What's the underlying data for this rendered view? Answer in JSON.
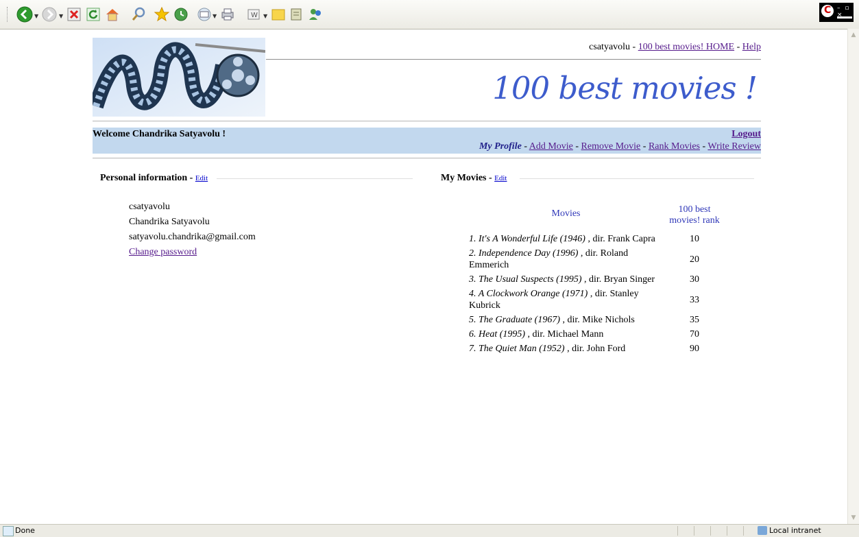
{
  "toolbar": {
    "icons": [
      "back-icon",
      "forward-icon",
      "stop-icon",
      "refresh-icon",
      "home-icon",
      "search-icon",
      "favorites-icon",
      "history-icon",
      "mail-icon",
      "print-icon",
      "word-icon",
      "folder-icon",
      "edit-icon",
      "messenger-icon"
    ]
  },
  "header": {
    "username": "csatyavolu",
    "separator": " - ",
    "home_link": "100 best movies! HOME",
    "help_link": "Help",
    "site_title": "100 best movies !"
  },
  "welcome": {
    "text": "Welcome Chandrika Satyavolu !",
    "logout": "Logout"
  },
  "menu": {
    "current": "My Profile",
    "items": [
      "Add Movie",
      "Remove Movie",
      "Rank Movies",
      "Write Review"
    ]
  },
  "personal": {
    "title": "Personal information",
    "edit": "Edit",
    "username": "csatyavolu",
    "fullname": "Chandrika Satyavolu",
    "email": "satyavolu.chandrika@gmail.com",
    "change_password": "Change password"
  },
  "my_movies": {
    "title": "My Movies",
    "edit": "Edit",
    "col_movies": "Movies",
    "col_rank": "100 best movies! rank",
    "rows": [
      {
        "title": "1. It's A Wonderful Life (1946)",
        "dir": " , dir. Frank Capra",
        "rank": "10"
      },
      {
        "title": "2. Independence Day (1996)",
        "dir": " , dir. Roland Emmerich",
        "rank": "20"
      },
      {
        "title": "3. The Usual Suspects (1995)",
        "dir": " , dir. Bryan Singer",
        "rank": "30"
      },
      {
        "title": "4. A Clockwork Orange (1971)",
        "dir": " , dir. Stanley Kubrick",
        "rank": "33"
      },
      {
        "title": "5. The Graduate (1967)",
        "dir": " , dir. Mike Nichols",
        "rank": "35"
      },
      {
        "title": "6. Heat (1995)",
        "dir": " , dir. Michael Mann",
        "rank": "70"
      },
      {
        "title": "7. The Quiet Man (1952)",
        "dir": " , dir. John Ford",
        "rank": "90"
      }
    ]
  },
  "status": {
    "left": "Done",
    "zone": "Local intranet"
  }
}
